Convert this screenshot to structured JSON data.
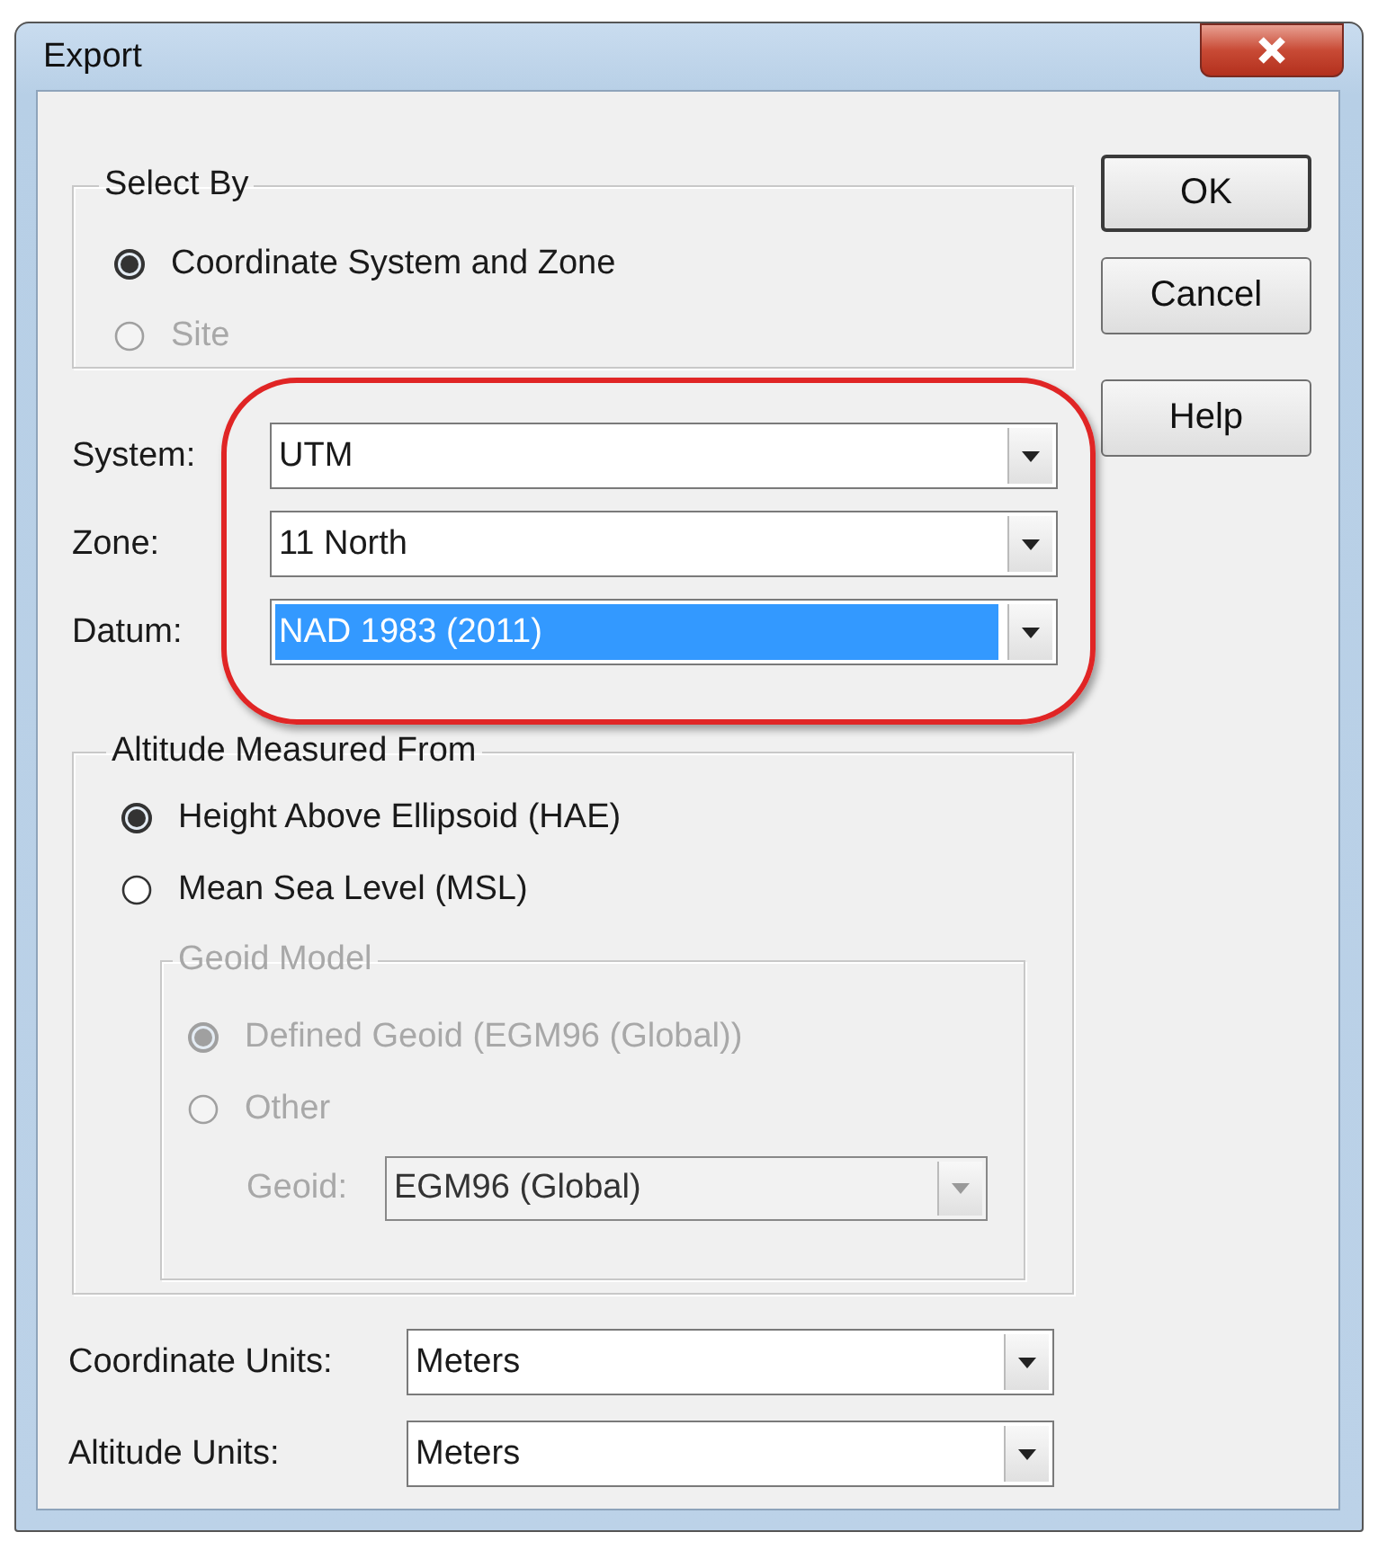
{
  "window": {
    "title": "Export"
  },
  "buttons": [
    {
      "label": "OK",
      "default": true
    },
    {
      "label": "Cancel",
      "default": false
    },
    {
      "label": "Help",
      "default": false
    }
  ],
  "select_by": {
    "title": "Select By",
    "options": [
      {
        "label": "Coordinate System and Zone",
        "selected": true,
        "disabled": false
      },
      {
        "label": "Site",
        "selected": false,
        "disabled": true
      }
    ]
  },
  "fields": [
    {
      "label": "System:",
      "value": "UTM",
      "focused": false
    },
    {
      "label": "Zone:",
      "value": "11 North",
      "focused": false
    },
    {
      "label": "Datum:",
      "value": "NAD 1983 (2011)",
      "focused": true
    }
  ],
  "altitude": {
    "title": "Altitude Measured From",
    "options": [
      {
        "label": "Height Above Ellipsoid (HAE)",
        "selected": true,
        "disabled": false
      },
      {
        "label": "Mean Sea Level (MSL)",
        "selected": false,
        "disabled": false
      }
    ],
    "geoid_model": {
      "title": "Geoid Model",
      "disabled": true,
      "options": [
        {
          "label": "Defined Geoid (EGM96 (Global))",
          "selected": true
        },
        {
          "label": "Other",
          "selected": false
        }
      ],
      "geoid": {
        "label": "Geoid:",
        "value": "EGM96 (Global)"
      }
    }
  },
  "units": [
    {
      "label": "Coordinate Units:",
      "value": "Meters"
    },
    {
      "label": "Altitude Units:",
      "value": "Meters"
    }
  ]
}
